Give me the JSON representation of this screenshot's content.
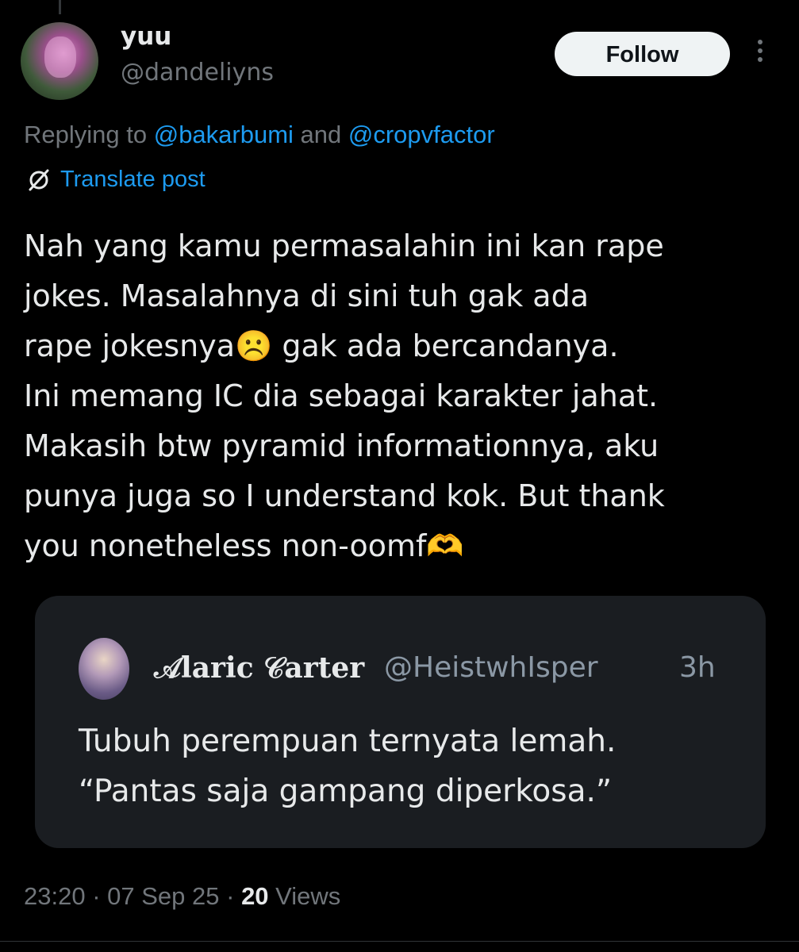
{
  "author": {
    "display_name": "yuu",
    "handle": "@dandeliyns",
    "follow_label": "Follow"
  },
  "reply": {
    "prefix": "Replying to ",
    "mention1": "@bakarbumi",
    "conjunction": " and ",
    "mention2": "@cropvfactor"
  },
  "translate_label": "Translate post",
  "post_text": "Nah yang kamu permasalahin ini kan rape\njokes. Masalahnya di sini tuh gak ada\nrape jokesnya☹️ gak ada bercandanya.\nIni memang IC dia sebagai karakter jahat.\nMakasih btw pyramid informationnya, aku\npunya juga so I understand kok. But thank\nyou nonetheless non-oomf🫶",
  "quote": {
    "display_name": "𝒜laric 𝒞arter",
    "handle": "@HeistwhIsper",
    "time": "3h",
    "text": "Tubuh perempuan ternyata lemah.\n“Pantas saja gampang diperkosa.”"
  },
  "meta": {
    "time": "23:20",
    "sep1": " · ",
    "date": "07 Sep 25",
    "sep2": " · ",
    "views_count": "20",
    "views_label": " Views"
  },
  "colors": {
    "background": "#000000",
    "text": "#e7e9ea",
    "secondary": "#71767b",
    "link": "#1d9bf0",
    "quote_bg": "#1a1d21"
  }
}
